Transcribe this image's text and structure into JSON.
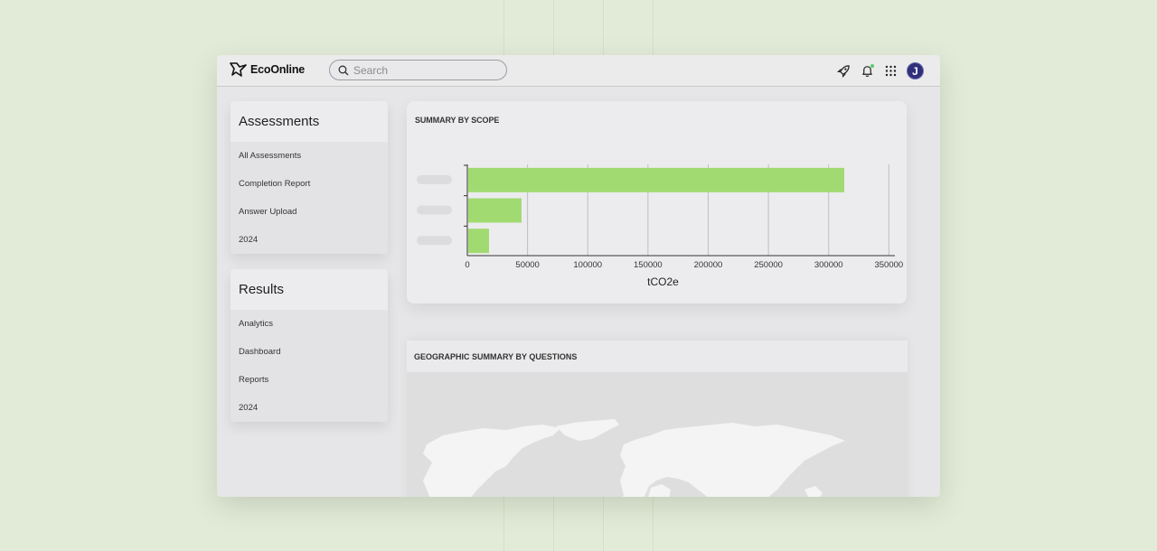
{
  "app": {
    "brand": "EcoOnline"
  },
  "search": {
    "placeholder": "Search"
  },
  "sidebar": {
    "assessments": {
      "title": "Assessments",
      "items": [
        "All Assessments",
        "Completion Report",
        "Answer Upload",
        "2024"
      ]
    },
    "results": {
      "title": "Results",
      "items": [
        "Analytics",
        "Dashboard",
        "Reports",
        "2024"
      ]
    }
  },
  "summary": {
    "title": "SUMMARY BY SCOPE"
  },
  "geo": {
    "title": "GEOGRAPHIC SUMMARY BY QUESTIONS"
  },
  "avatar": {
    "initial": "J"
  },
  "icons": [
    "search-icon",
    "rocket-icon",
    "bell-icon",
    "apps-grid-icon"
  ],
  "colors": {
    "bar": "#a2da72",
    "avatar": "#2f2f7a",
    "notification": "#5cc96a"
  },
  "chart_data": {
    "type": "bar",
    "orientation": "horizontal",
    "categories": [
      "",
      "",
      ""
    ],
    "values": [
      313000,
      45000,
      18000
    ],
    "xlabel": "tCO2e",
    "ylabel": "",
    "xlim": [
      0,
      355000
    ],
    "xticks": [
      0,
      50000,
      100000,
      150000,
      200000,
      250000,
      300000,
      350000
    ],
    "grid": "vertical"
  }
}
